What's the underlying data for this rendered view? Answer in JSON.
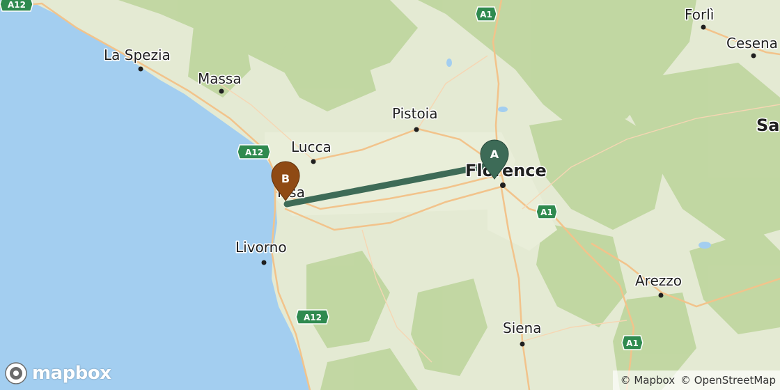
{
  "map": {
    "provider": "mapbox",
    "route": {
      "from_marker": "A",
      "to_marker": "B",
      "color": "#3e6b57"
    },
    "markers": [
      {
        "label": "A",
        "place": "Florence",
        "color": "#3d6b57"
      },
      {
        "label": "B",
        "place": "Pisa",
        "color": "#8f4a14"
      }
    ],
    "cities": [
      "Forlì",
      "Cesena",
      "La Spezia",
      "Massa",
      "Pistoia",
      "Lucca",
      "Florence",
      "Pisa",
      "Livorno",
      "Arezzo",
      "Siena",
      "Sa"
    ],
    "highways": [
      "A1",
      "A12",
      "A12",
      "A12",
      "A1",
      "A1"
    ],
    "colors": {
      "sea": "#a3cef0",
      "land": "#e6ecd6",
      "forest": "#b9d296",
      "road": "#f3c48c"
    }
  },
  "attribution": {
    "mapbox": "© Mapbox",
    "osm": "© OpenStreetMap"
  },
  "logo": {
    "text": "mapbox"
  }
}
